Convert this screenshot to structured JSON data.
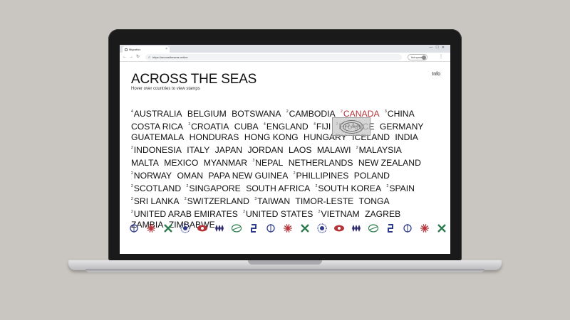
{
  "browser": {
    "tab_title": "Migration",
    "url": "https://acrosstheseas.online",
    "sync_label": "Not syncing",
    "tab_close": "×",
    "window_controls": "—☐✕",
    "back": "←",
    "forward": "→",
    "reload": "↻",
    "menu": "⋮"
  },
  "page": {
    "title": "ACROSS THE SEAS",
    "subtitle": "Hover over countries to view stamps",
    "info_label": "Info"
  },
  "countries": [
    {
      "sup": "4",
      "name": "AUSTRALIA"
    },
    {
      "sup": "",
      "name": "BELGIUM"
    },
    {
      "sup": "",
      "name": "BOTSWANA"
    },
    {
      "sup": "2",
      "name": "CAMBODIA"
    },
    {
      "sup": "2",
      "name": "CANADA",
      "highlighted": true
    },
    {
      "sup": "3",
      "name": "CHINA"
    },
    {
      "sup": "",
      "name": "COSTA RICA"
    },
    {
      "sup": "2",
      "name": "CROATIA"
    },
    {
      "sup": "",
      "name": "CUBA"
    },
    {
      "sup": "4",
      "name": "ENGLAND"
    },
    {
      "sup": "4",
      "name": "FIJI"
    },
    {
      "sup": "2",
      "name": "FRANCE"
    },
    {
      "sup": "",
      "name": "GERMANY"
    },
    {
      "sup": "",
      "name": "GUATEMALA"
    },
    {
      "sup": "",
      "name": "HONDURAS"
    },
    {
      "sup": "",
      "name": "HONG KONG"
    },
    {
      "sup": "",
      "name": "HUNGARY"
    },
    {
      "sup": "",
      "name": "ICELAND"
    },
    {
      "sup": "",
      "name": "INDIA"
    },
    {
      "sup": "2",
      "name": "INDONESIA"
    },
    {
      "sup": "",
      "name": "ITALY"
    },
    {
      "sup": "",
      "name": "JAPAN"
    },
    {
      "sup": "",
      "name": "JORDAN"
    },
    {
      "sup": "",
      "name": "LAOS"
    },
    {
      "sup": "",
      "name": "MALAWI"
    },
    {
      "sup": "2",
      "name": "MALAYSIA"
    },
    {
      "sup": "",
      "name": "MALTA"
    },
    {
      "sup": "",
      "name": "MEXICO"
    },
    {
      "sup": "",
      "name": "MYANMAR"
    },
    {
      "sup": "3",
      "name": "NEPAL"
    },
    {
      "sup": "",
      "name": "NETHERLANDS"
    },
    {
      "sup": "",
      "name": "NEW ZEALAND"
    },
    {
      "sup": "2",
      "name": "NORWAY"
    },
    {
      "sup": "",
      "name": "OMAN"
    },
    {
      "sup": "",
      "name": "PAPA NEW GUINEA"
    },
    {
      "sup": "2",
      "name": "PHILLIPINES"
    },
    {
      "sup": "",
      "name": "POLAND"
    },
    {
      "sup": "2",
      "name": "SCOTLAND"
    },
    {
      "sup": "2",
      "name": "SINGAPORE"
    },
    {
      "sup": "",
      "name": "SOUTH AFRICA"
    },
    {
      "sup": "2",
      "name": "SOUTH KOREA"
    },
    {
      "sup": "2",
      "name": "SPAIN"
    },
    {
      "sup": "2",
      "name": "SRI LANKA"
    },
    {
      "sup": "2",
      "name": "SWITZERLAND"
    },
    {
      "sup": "3",
      "name": "TAIWAN"
    },
    {
      "sup": "",
      "name": "TIMOR-LESTE"
    },
    {
      "sup": "",
      "name": "TONGA"
    },
    {
      "sup": "2",
      "name": "UNITED ARAB EMIRATES"
    },
    {
      "sup": "2",
      "name": "UNITED STATES"
    },
    {
      "sup": "2",
      "name": "VIETNAM"
    },
    {
      "sup": "",
      "name": "ZAGREB"
    },
    {
      "sup": "",
      "name": "ZAMBIA"
    },
    {
      "sup": "",
      "name": "ZIMBABWE"
    }
  ],
  "stamp_popup": {
    "text": "ICELAND"
  },
  "icon_row": [
    {
      "name": "ring-arrow-icon",
      "color": "#2e3a8c"
    },
    {
      "name": "starburst-icon",
      "color": "#b4343a"
    },
    {
      "name": "cross-icon",
      "color": "#2e7d4f"
    },
    {
      "name": "dotted-sphere-icon",
      "color": "#2e3a8c"
    },
    {
      "name": "eye-icon",
      "color": "#b4343a"
    },
    {
      "name": "triple-diamond-icon",
      "color": "#2e2a6e"
    },
    {
      "name": "knot-icon",
      "color": "#2e7d4f"
    },
    {
      "name": "link-icon",
      "color": "#2e3a8c"
    }
  ],
  "colors": {
    "highlight": "#b4343a",
    "text": "#111111"
  }
}
